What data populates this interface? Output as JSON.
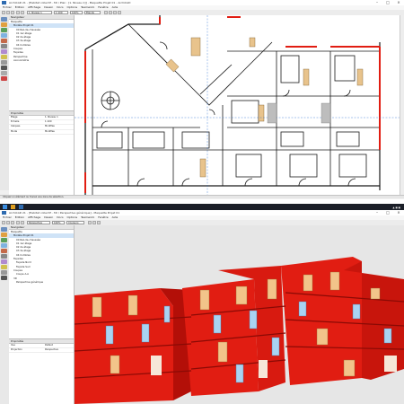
{
  "top_window": {
    "title": "ArchiCAD 21 - [Habitat collectif - 3D / Plan : [1. Niveau 1]] - Maquette Projet 01 - ArchiCAD",
    "menus": [
      "Fichier",
      "Édition",
      "Affichage",
      "Dessin",
      "Docs",
      "Options",
      "Teamwork",
      "Fenêtre",
      "Aide"
    ],
    "toolbar_fields": [
      "1. Niveau 1",
      "1:100",
      "100%",
      "Étendu"
    ],
    "browser_header": "Navigateur",
    "tree": [
      {
        "label": "Maquette",
        "level": 0
      },
      {
        "label": "Modèle Projet 01",
        "level": 1
      },
      {
        "label": "00 Rez-de-chaussée",
        "level": 2
      },
      {
        "label": "01 1er étage",
        "level": 2
      },
      {
        "label": "02 2e étage",
        "level": 2
      },
      {
        "label": "03 3e étage",
        "level": 2
      },
      {
        "label": "04 Combles",
        "level": 2
      },
      {
        "label": "Coupes",
        "level": 1
      },
      {
        "label": "Façades",
        "level": 1
      },
      {
        "label": "Perspective",
        "level": 1
      },
      {
        "label": "Axonométrie",
        "level": 1
      }
    ],
    "props_header": "Propriétés",
    "props": [
      {
        "k": "Étage",
        "v": "1. Niveau 1"
      },
      {
        "k": "Échelle",
        "v": "1:100"
      },
      {
        "k": "Calques",
        "v": "Modifiés"
      },
      {
        "k": "Mode",
        "v": "Modifiés"
      }
    ],
    "status": "Cliquez un élément ou tracez une zone de sélection."
  },
  "bottom_window": {
    "title": "ArchiCAD 21 - [Habitat collectif - 3D / Perspective générique] - Maquette Projet 01",
    "menus": [
      "Fichier",
      "Édition",
      "Affichage",
      "Dessin",
      "Docs",
      "Options",
      "Teamwork",
      "Fenêtre",
      "Aide"
    ],
    "toolbar_fields": [
      "Perspective",
      "100%",
      "Couleurs"
    ],
    "browser_header": "Navigateur",
    "tree": [
      {
        "label": "Maquette",
        "level": 0
      },
      {
        "label": "Modèle Projet 01",
        "level": 1
      },
      {
        "label": "00 Rez-de-chaussée",
        "level": 2
      },
      {
        "label": "01 1er étage",
        "level": 2
      },
      {
        "label": "02 2e étage",
        "level": 2
      },
      {
        "label": "03 3e étage",
        "level": 2
      },
      {
        "label": "04 Combles",
        "level": 2
      },
      {
        "label": "Façades",
        "level": 1
      },
      {
        "label": "Façade Nord",
        "level": 2
      },
      {
        "label": "Façade Sud",
        "level": 2
      },
      {
        "label": "Coupes",
        "level": 1
      },
      {
        "label": "Coupe A-A",
        "level": 2
      },
      {
        "label": "3D",
        "level": 1
      },
      {
        "label": "Perspective générique",
        "level": 2
      }
    ],
    "props_header": "Propriétés",
    "props": [
      {
        "k": "Vue",
        "v": "Défaut"
      },
      {
        "k": "Projection",
        "v": "Perspective"
      }
    ]
  },
  "colors": {
    "wall_red": "#e11d12",
    "wall_dark": "#b30f08",
    "facade_tan": "#f2c48a",
    "glass_blue": "#a9d3f2",
    "bg_grey": "#e6e6e6",
    "plan_line": "#1a1a1a"
  },
  "icons": [
    "app-icon",
    "minimize-icon",
    "maximize-icon",
    "close-icon",
    "windows-start-icon"
  ]
}
